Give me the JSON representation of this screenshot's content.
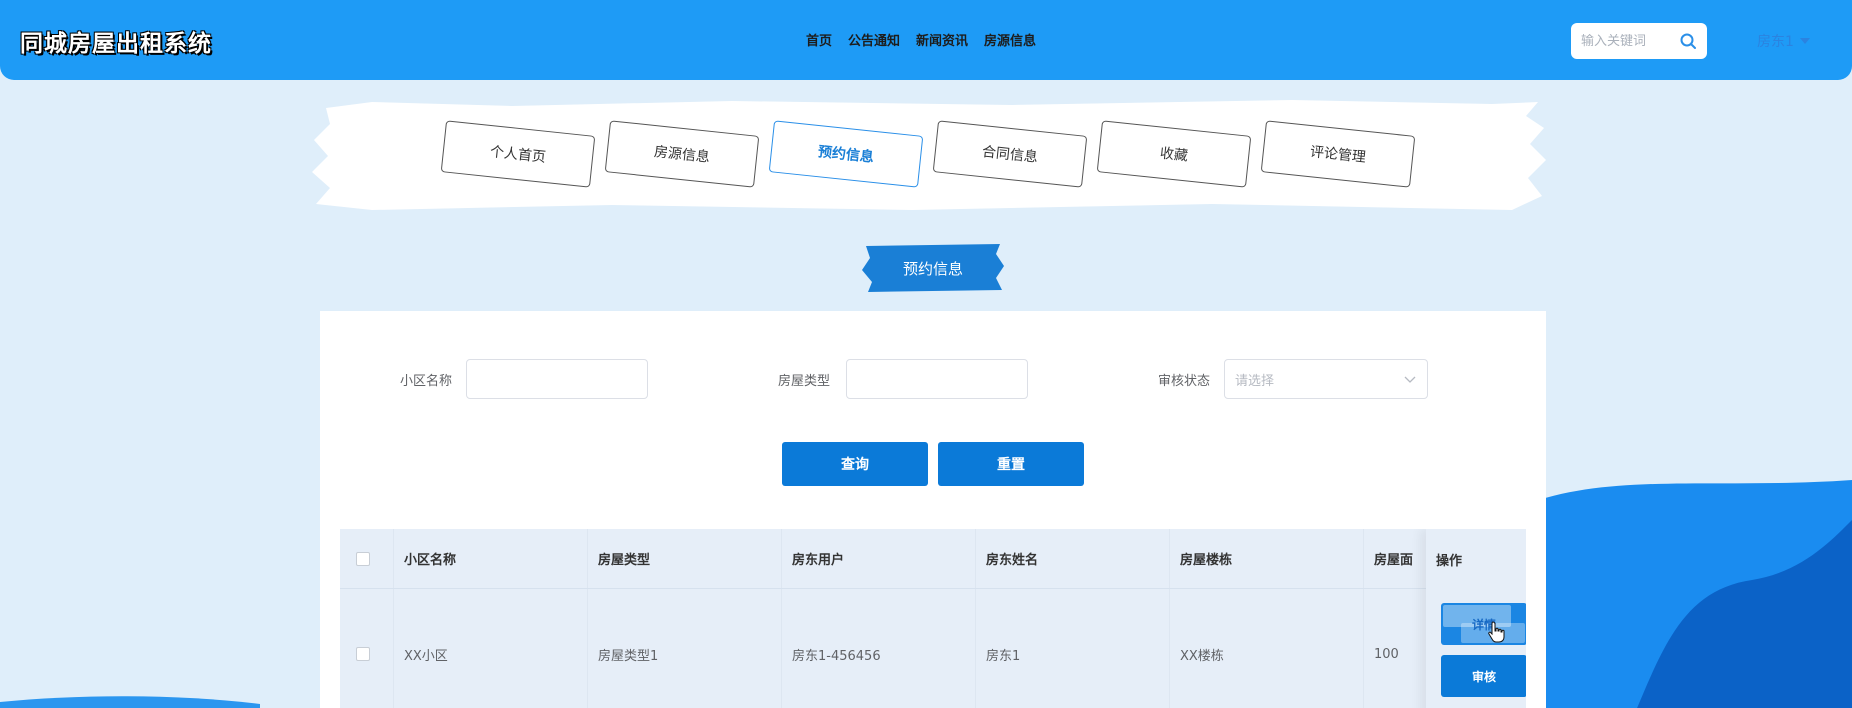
{
  "header": {
    "brand": "同城房屋出租系统",
    "nav": [
      "首页",
      "公告通知",
      "新闻资讯",
      "房源信息"
    ],
    "search_placeholder": "输入关键词",
    "user": "房东1"
  },
  "tabs": [
    {
      "label": "个人首页",
      "active": false
    },
    {
      "label": "房源信息",
      "active": false
    },
    {
      "label": "预约信息",
      "active": true
    },
    {
      "label": "合同信息",
      "active": false
    },
    {
      "label": "收藏",
      "active": false
    },
    {
      "label": "评论管理",
      "active": false
    }
  ],
  "section_title": "预约信息",
  "filters": {
    "community_label": "小区名称",
    "community_value": "",
    "house_type_label": "房屋类型",
    "house_type_value": "",
    "review_status_label": "审核状态",
    "review_status_placeholder": "请选择",
    "query_button": "查询",
    "reset_button": "重置"
  },
  "table": {
    "columns": [
      "小区名称",
      "房屋类型",
      "房东用户",
      "房东姓名",
      "房屋楼栋",
      "房屋面"
    ],
    "ops_header": "操作",
    "rows": [
      {
        "cells": [
          "XX小区",
          "房屋类型1",
          "房东1-456456",
          "房东1",
          "XX楼栋",
          "100"
        ],
        "detail_button": "详情",
        "review_button": "审核"
      }
    ]
  },
  "colors": {
    "header_bg": "#1e9bf6",
    "page_bg": "#dfeefa",
    "primary_button": "#0b7ad8",
    "active_tab": "#2a8fe8"
  }
}
